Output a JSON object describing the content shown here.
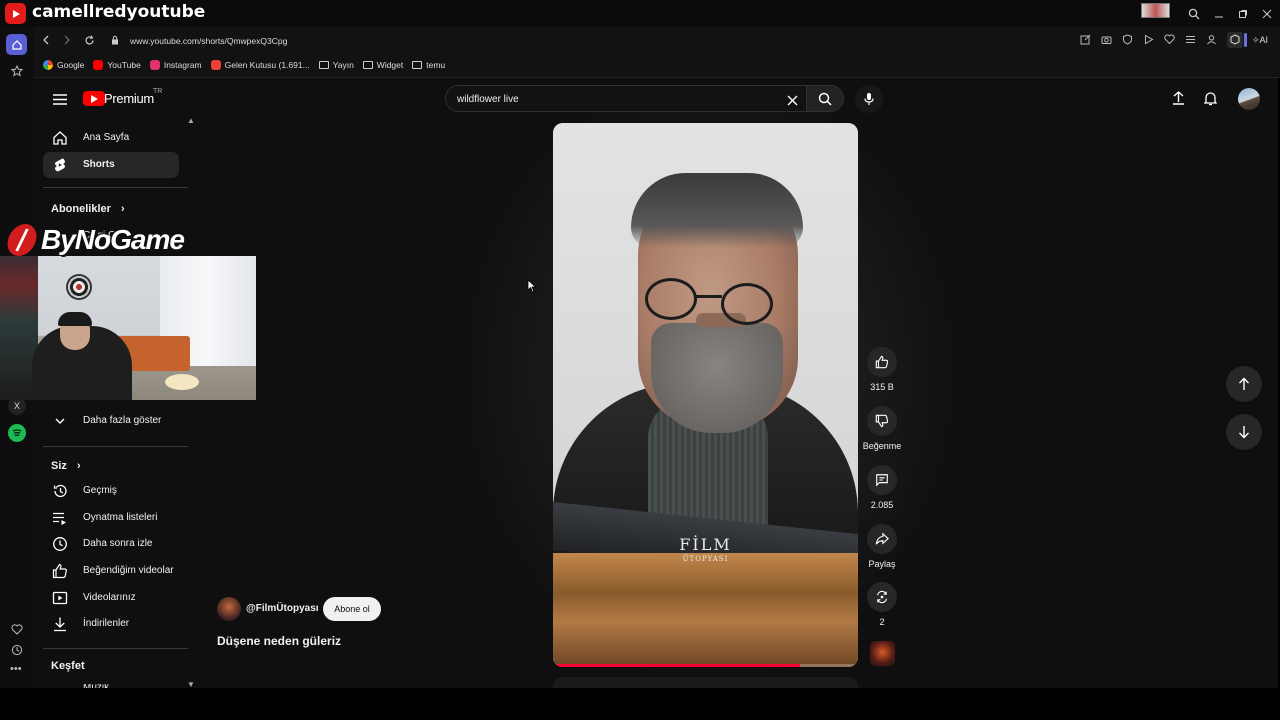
{
  "window": {
    "channel_title": "camellredyoutube"
  },
  "browser": {
    "url": "www.youtube.com/shorts/QmwpexQ3Cpg",
    "ai_label": "AI",
    "bookmarks": [
      {
        "label": "Google",
        "icon": "google-icon",
        "color": "#4285f4"
      },
      {
        "label": "YouTube",
        "icon": "youtube-icon",
        "color": "#ff0000"
      },
      {
        "label": "Instagram",
        "icon": "instagram-icon",
        "color": "#e1306c"
      },
      {
        "label": "Gelen Kutusu (1.691...",
        "icon": "gmail-icon",
        "color": "#ea4335"
      },
      {
        "label": "Yayın",
        "icon": "folder-icon",
        "color": "#cccccc"
      },
      {
        "label": "Widget",
        "icon": "folder-icon",
        "color": "#cccccc"
      },
      {
        "label": "temu",
        "icon": "folder-icon",
        "color": "#cccccc"
      }
    ]
  },
  "youtube": {
    "logo_text": "Premium",
    "logo_region": "TR",
    "search_value": "wildflower live",
    "sidebar": {
      "main": [
        {
          "label": "Ana Sayfa",
          "icon": "home-icon"
        },
        {
          "label": "Shorts",
          "icon": "shorts-icon",
          "active": true
        }
      ],
      "subscriptions_header": "Abonelikler",
      "partial_sub": "Çizgi C",
      "more_label": "Daha fazla göster",
      "you_header": "Siz",
      "you_items": [
        {
          "label": "Geçmiş",
          "icon": "history-icon"
        },
        {
          "label": "Oynatma listeleri",
          "icon": "playlist-icon"
        },
        {
          "label": "Daha sonra izle",
          "icon": "clock-icon"
        },
        {
          "label": "Beğendiğim videolar",
          "icon": "thumbs-up-icon"
        },
        {
          "label": "Videolarınız",
          "icon": "video-icon"
        },
        {
          "label": "İndirilenler",
          "icon": "download-icon"
        }
      ],
      "explore_header": "Keşfet",
      "explore_partial": "Müzik"
    },
    "short": {
      "channel": "@FilmÜtopyası",
      "subscribe_label": "Abone ol",
      "title": "Düşene neden güleriz",
      "watermark_line1": "FİLM",
      "watermark_line2": "ÜTOPYASI",
      "progress": 0.81
    },
    "actions": {
      "likes": "315 B",
      "dislike_label": "Beğenme",
      "comments": "2.085",
      "share_label": "Paylaş",
      "remix_count": "2"
    }
  },
  "overlay": {
    "brand": "ByNoGame"
  }
}
